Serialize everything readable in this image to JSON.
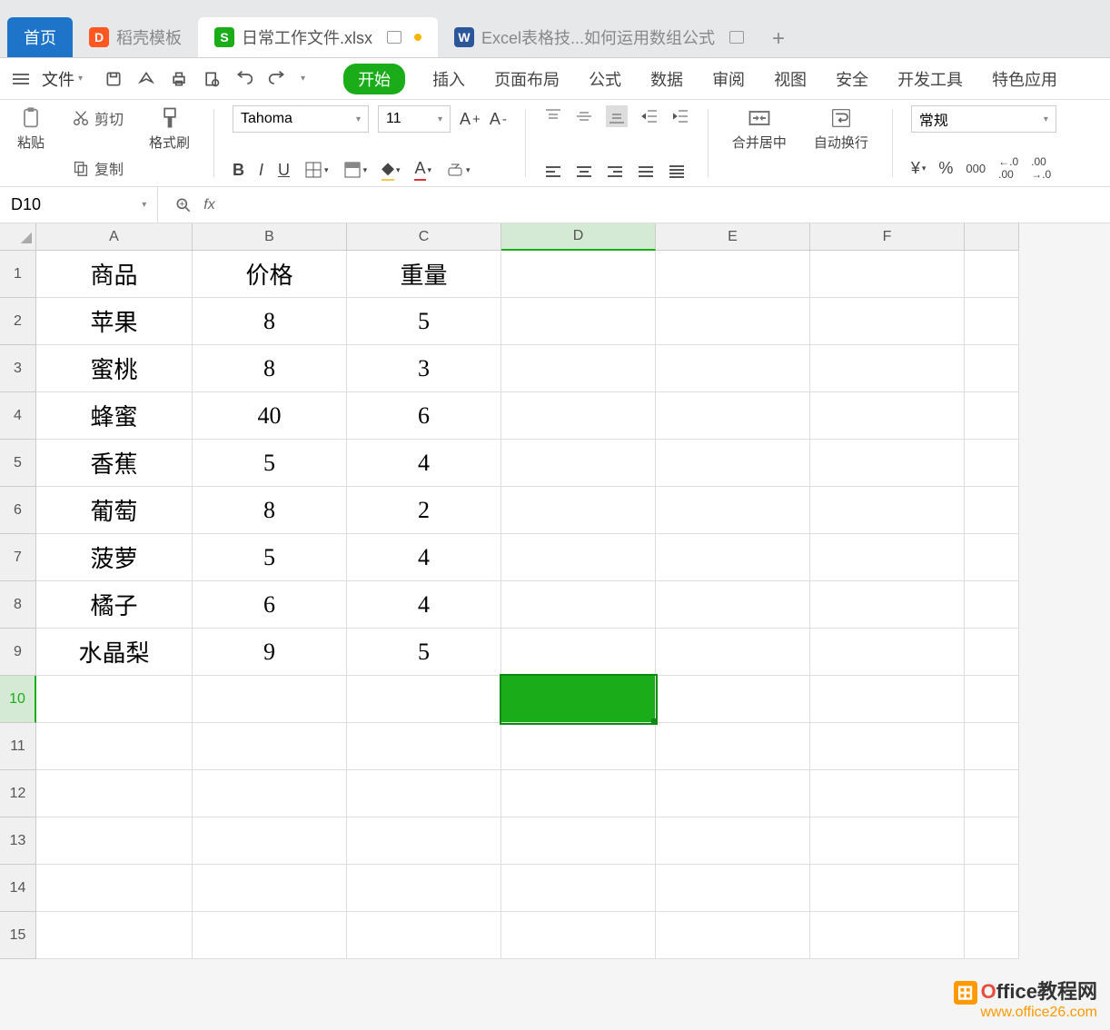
{
  "tabs": {
    "home": "首页",
    "t1": "稻壳模板",
    "t2": "日常工作文件.xlsx",
    "t3": "Excel表格技...如何运用数组公式"
  },
  "menu": {
    "file": "文件"
  },
  "ribbon": {
    "start": "开始",
    "insert": "插入",
    "layout": "页面布局",
    "formula": "公式",
    "data": "数据",
    "review": "审阅",
    "view": "视图",
    "security": "安全",
    "dev": "开发工具",
    "special": "特色应用"
  },
  "toolbar": {
    "paste": "粘贴",
    "cut": "剪切",
    "copy": "复制",
    "fmtpaint": "格式刷",
    "font": "Tahoma",
    "size": "11",
    "merge": "合并居中",
    "wrap": "自动换行",
    "numfmt": "常规"
  },
  "namebox": "D10",
  "columns": [
    "A",
    "B",
    "C",
    "D",
    "E",
    "F"
  ],
  "headers": {
    "a": "商品",
    "b": "价格",
    "c": "重量"
  },
  "rows": [
    {
      "a": "苹果",
      "b": "8",
      "c": "5"
    },
    {
      "a": "蜜桃",
      "b": "8",
      "c": "3"
    },
    {
      "a": "蜂蜜",
      "b": "40",
      "c": "6"
    },
    {
      "a": "香蕉",
      "b": "5",
      "c": "4"
    },
    {
      "a": "葡萄",
      "b": "8",
      "c": "2"
    },
    {
      "a": "菠萝",
      "b": "5",
      "c": "4"
    },
    {
      "a": "橘子",
      "b": "6",
      "c": "4"
    },
    {
      "a": "水晶梨",
      "b": "9",
      "c": "5"
    }
  ],
  "watermark": {
    "l1a": "ffice",
    "l1b": "教程网",
    "l2": "www.office26.com"
  }
}
